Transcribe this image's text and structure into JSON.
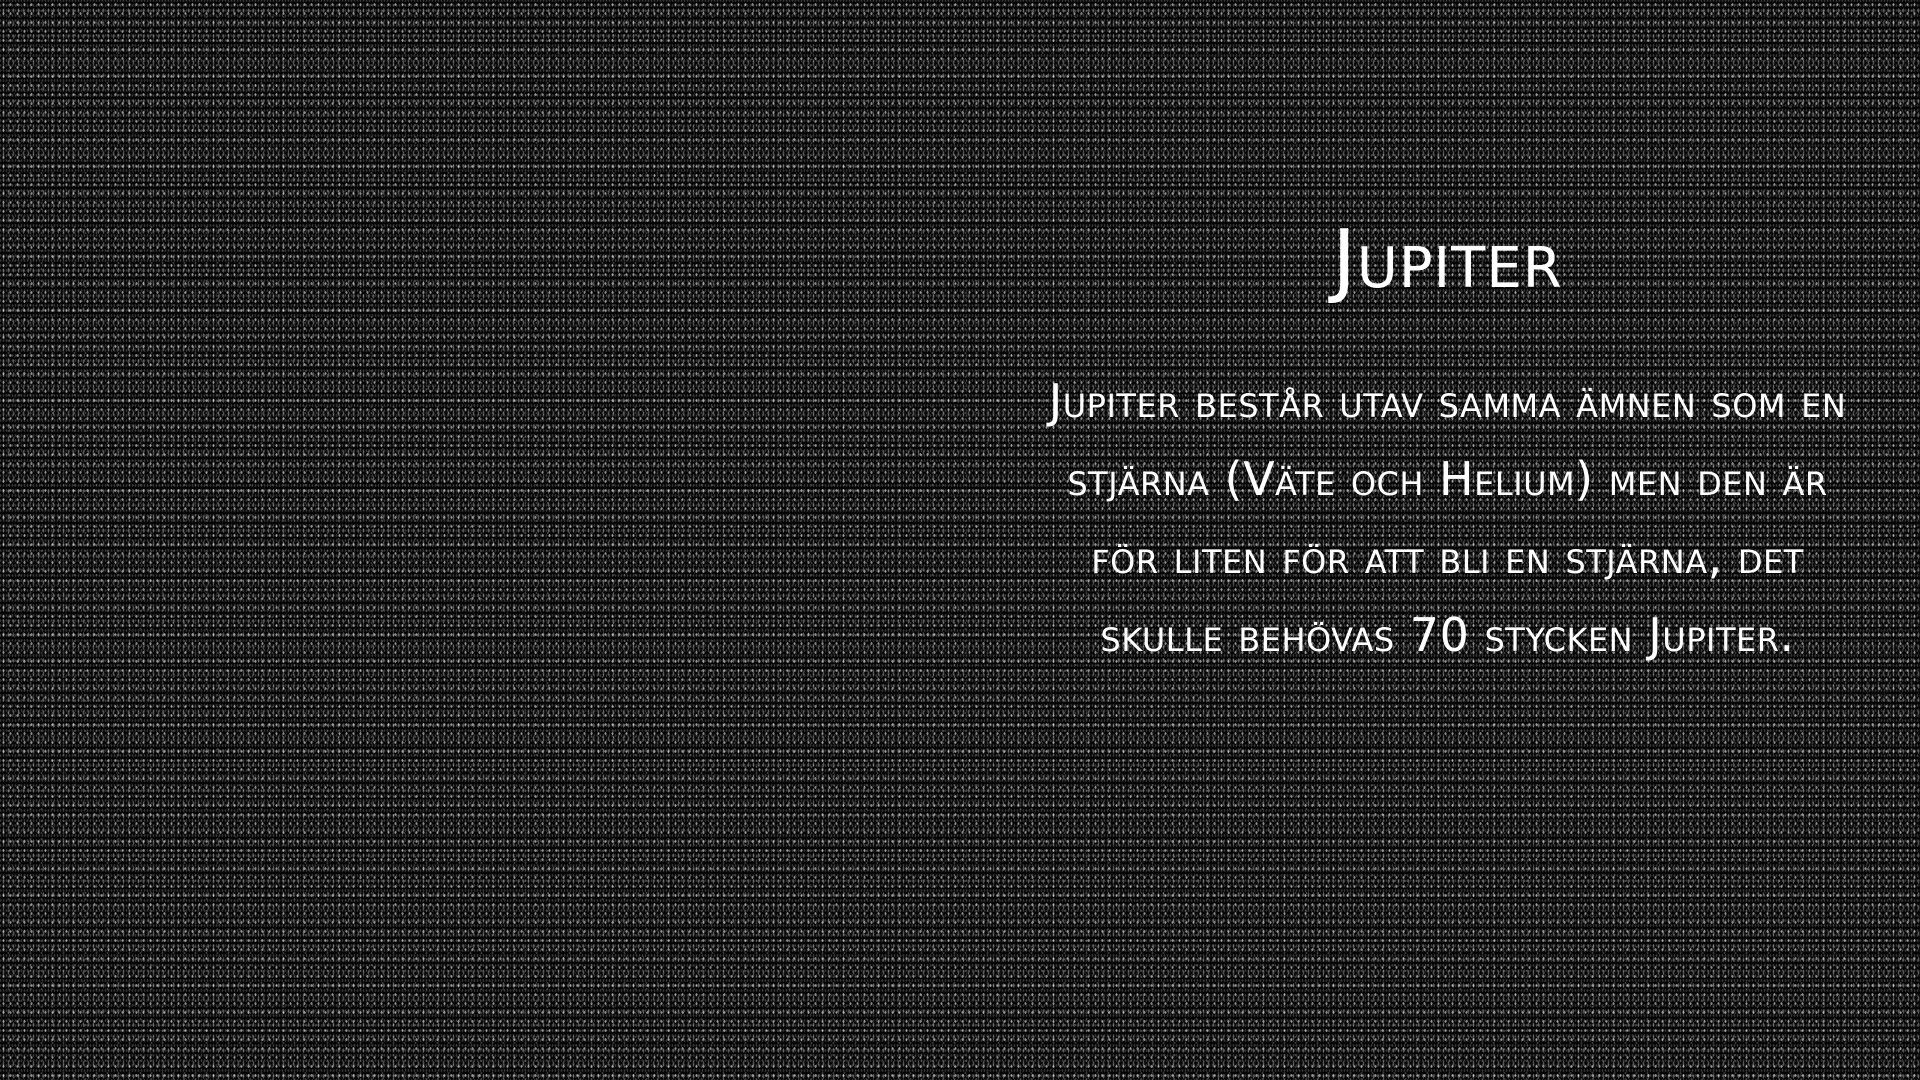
{
  "slide": {
    "title": "Jupiter",
    "body": "Jupiter består utav samma ämnen som en stjärna (Väte och Helium) men den är för liten för att bli en stjärna, det skulle behövas 70 stycken Jupiter."
  }
}
